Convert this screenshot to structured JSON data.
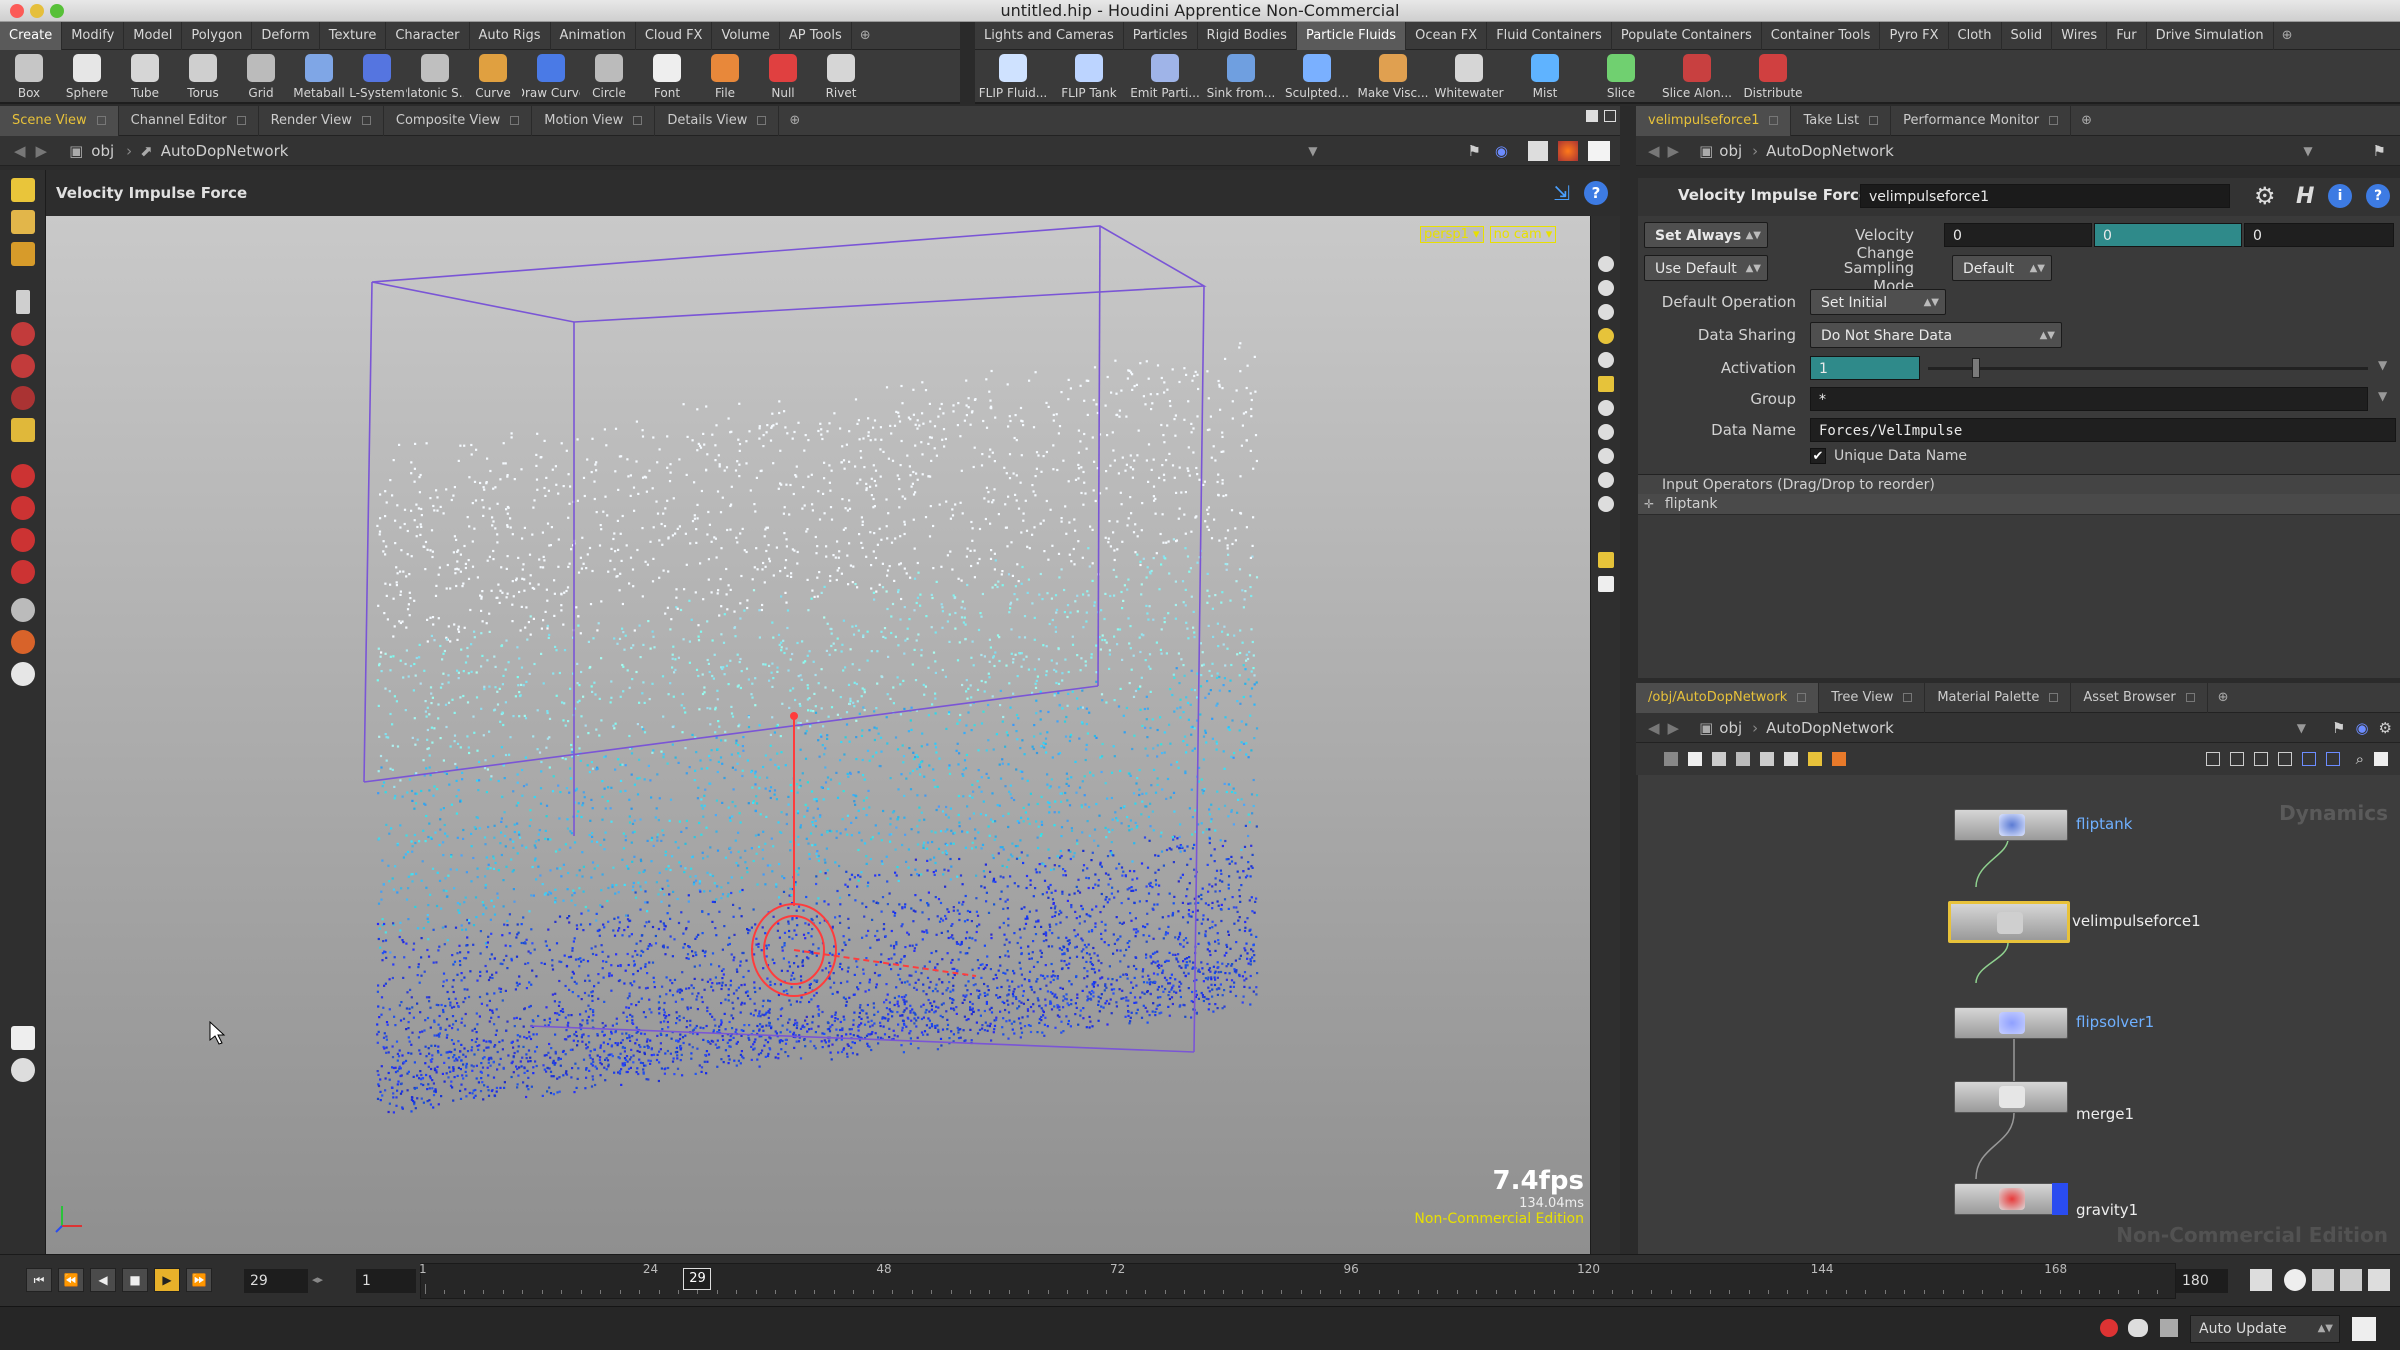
{
  "window": {
    "title": "untitled.hip - Houdini Apprentice Non-Commercial"
  },
  "shelf_left": {
    "tabs": [
      "Create",
      "Modify",
      "Model",
      "Polygon",
      "Deform",
      "Texture",
      "Character",
      "Auto Rigs",
      "Animation",
      "Cloud FX",
      "Volume",
      "AP Tools"
    ],
    "active_tab": "Create",
    "tools": [
      "Box",
      "Sphere",
      "Tube",
      "Torus",
      "Grid",
      "Metaball",
      "L-System",
      "Platonic S...",
      "Curve",
      "Draw Curve",
      "Circle",
      "Font",
      "File",
      "Null",
      "Rivet"
    ]
  },
  "shelf_right": {
    "tabs": [
      "Lights and Cameras",
      "Particles",
      "Rigid Bodies",
      "Particle Fluids",
      "Ocean FX",
      "Fluid Containers",
      "Populate Containers",
      "Container Tools",
      "Pyro FX",
      "Cloth",
      "Solid",
      "Wires",
      "Fur",
      "Drive Simulation"
    ],
    "active_tab": "Particle Fluids",
    "tools": [
      "FLIP Fluid...",
      "FLIP Tank",
      "Emit Parti...",
      "Sink from...",
      "Sculpted...",
      "Make Visc...",
      "Whitewater",
      "Mist",
      "Slice",
      "Slice Alon...",
      "Distribute"
    ]
  },
  "viewer": {
    "tabs": [
      "Scene View",
      "Channel Editor",
      "Render View",
      "Composite View",
      "Motion View",
      "Details View"
    ],
    "active_tab": "Scene View",
    "path": {
      "root": "obj",
      "node": "AutoDopNetwork"
    },
    "title": "Velocity Impulse Force",
    "camera_menu": "persp1",
    "cam_menu": "no cam",
    "fps": "7.4fps",
    "frame_ms": "134.04ms",
    "edition": "Non-Commercial Edition"
  },
  "params_pane": {
    "tabs": [
      "velimpulseforce1",
      "Take List",
      "Performance Monitor"
    ],
    "path": {
      "root": "obj",
      "node": "AutoDopNetwork"
    },
    "node_type": "Velocity Impulse Force",
    "node_name": "velimpulseforce1",
    "set_always": "Set Always",
    "use_default": "Use Default",
    "velocity_change_label": "Velocity Change",
    "velocity_change": [
      "0",
      "0",
      "0"
    ],
    "sampling_mode_label": "Sampling Mode",
    "sampling_mode": "Default",
    "default_operation_label": "Default Operation",
    "default_operation": "Set Initial",
    "data_sharing_label": "Data Sharing",
    "data_sharing": "Do Not Share Data",
    "activation_label": "Activation",
    "activation": "1",
    "activation_slider_fraction": 0.1,
    "group_label": "Group",
    "group": "*",
    "data_name_label": "Data Name",
    "data_name": "Forces/VelImpulse",
    "unique_data_name": "Unique Data Name",
    "input_operators_label": "Input Operators (Drag/Drop to reorder)",
    "input_operator": "fliptank"
  },
  "network_pane": {
    "tabs": [
      "/obj/AutoDopNetwork",
      "Tree View",
      "Material Palette",
      "Asset Browser"
    ],
    "path": {
      "root": "obj",
      "node": "AutoDopNetwork"
    },
    "context_label": "Dynamics",
    "watermark": "Non-Commercial Edition",
    "nodes": [
      "fliptank",
      "velimpulseforce1",
      "flipsolver1",
      "merge1",
      "gravity1"
    ]
  },
  "timeline": {
    "current_frame": "29",
    "start_frame": "1",
    "end_frame": "180",
    "ticks": [
      "1",
      "24",
      "48",
      "72",
      "96",
      "120",
      "144",
      "168"
    ],
    "marker": "29"
  },
  "status": {
    "auto_update": "Auto Update"
  },
  "colors": {
    "accent_yellow": "#e8c23a",
    "flip_blue": "#1730e8",
    "flip_cyan": "#3ee0e0",
    "container_purple": "#7a55d6",
    "node_link_blue": "#6fb0ff"
  }
}
